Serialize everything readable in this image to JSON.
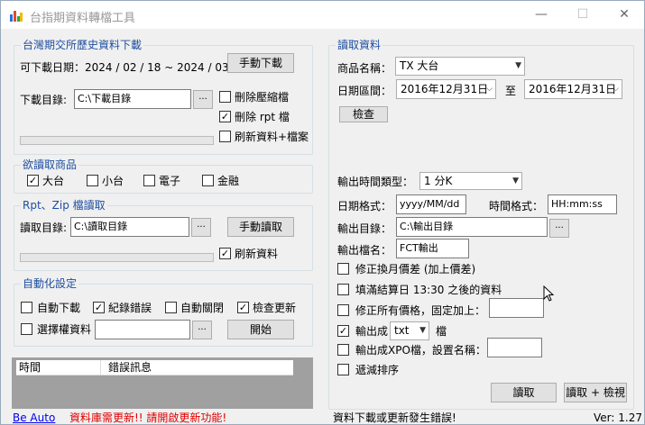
{
  "window": {
    "title": "台指期資料轉檔工具",
    "minimize": "—",
    "maximize": "☐",
    "close": "✕"
  },
  "download_group": {
    "title": "台灣期交所歷史資料下載",
    "date_label": "可下載日期：2024 / 02 / 18 ~ 2024 / 03 / 16",
    "manual_download": "手動下載",
    "dir_label": "下載目錄:",
    "dir_value": "C:\\下載目錄",
    "browse": "...",
    "opt_delete_zip": "刪除壓縮檔",
    "opt_delete_rpt": "刪除 rpt 檔",
    "opt_refresh": "刷新資料+檔案",
    "delete_zip_checked": false,
    "delete_rpt_checked": true,
    "refresh_checked": false
  },
  "products_group": {
    "title": "欲讀取商品",
    "items": [
      {
        "label": "大台",
        "checked": true
      },
      {
        "label": "小台",
        "checked": false
      },
      {
        "label": "電子",
        "checked": false
      },
      {
        "label": "金融",
        "checked": false
      }
    ]
  },
  "rpt_group": {
    "title": "Rpt、Zip 檔讀取",
    "dir_label": "讀取目錄:",
    "dir_value": "C:\\讀取目錄",
    "browse": "...",
    "manual_read": "手動讀取",
    "opt_refresh": "刷新資料",
    "refresh_checked": true
  },
  "auto_group": {
    "title": "自動化設定",
    "opt_auto_download": "自動下載",
    "opt_log_errors": "紀錄錯誤",
    "opt_auto_close": "自動關閉",
    "opt_check_update": "檢查更新",
    "opt_options_data": "選擇權資料",
    "auto_download_checked": false,
    "log_errors_checked": true,
    "auto_close_checked": false,
    "check_update_checked": true,
    "options_data_checked": false,
    "options_value": "",
    "browse": "...",
    "start": "開始"
  },
  "log_table": {
    "columns": [
      "時間",
      "錯誤訊息"
    ]
  },
  "read_group": {
    "title": "讀取資料",
    "product_label": "商品名稱：",
    "product_value": "TX  大台",
    "range_label": "日期區間：",
    "start_date": "2016年12月31日",
    "to_label": "至",
    "end_date": "2016年12月31日",
    "check_button": "檢查",
    "interval_label": "輸出時間類型：",
    "interval_value": "1 分K",
    "date_fmt_label": "日期格式：",
    "date_fmt_value": "yyyy/MM/dd",
    "time_fmt_label": "時間格式：",
    "time_fmt_value": "HH:mm:ss",
    "out_dir_label": "輸出目錄：",
    "out_dir_value": "C:\\輸出目錄",
    "browse": "...",
    "out_name_label": "輸出檔名：",
    "out_name_value": "FCT輸出",
    "opt_fix_spread": "修正換月價差 (加上價差)",
    "opt_fill_settle": "填滿結算日 13:30 之後的資料",
    "opt_fix_price": "修正所有價格，固定加上：",
    "opt_output_as": "輸出成",
    "output_format": "txt",
    "output_suffix": "檔",
    "opt_output_xpo": "輸出成XPO檔，設置名稱：",
    "opt_descending": "遞減排序",
    "fix_spread_checked": false,
    "fill_settle_checked": false,
    "fix_price_checked": false,
    "output_as_checked": true,
    "output_xpo_checked": false,
    "descending_checked": false,
    "fix_price_value": "",
    "xpo_name_value": "",
    "read_button": "讀取",
    "read_view_button": "讀取 + 檢視"
  },
  "status_bar": {
    "link": "Be Auto",
    "warning": "資料庫需更新!! 請開啟更新功能!",
    "message": "資料下載或更新發生錯誤!",
    "version": "Ver: 1.27"
  },
  "colors": {
    "group_title": "#1f4fa0",
    "warning": "#e00000",
    "link": "#0000ee",
    "log_bg": "#a0a0a0"
  }
}
